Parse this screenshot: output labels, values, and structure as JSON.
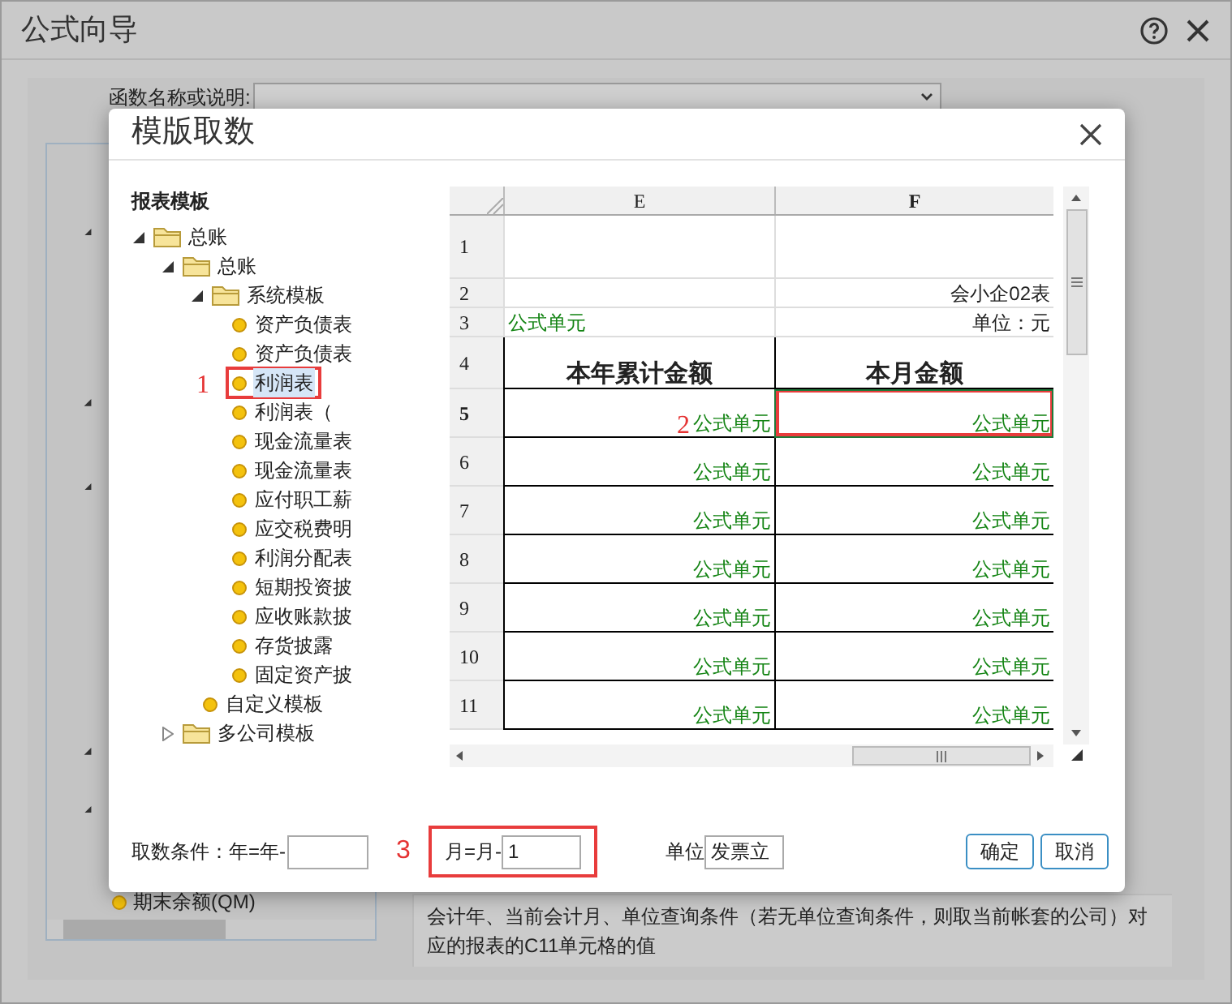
{
  "window": {
    "title": "公式向导"
  },
  "function_search": {
    "label": "函数名称或说明:"
  },
  "function_list": {
    "bottom_item": "期末余额(QM)"
  },
  "description": "会计年、当前会计月、单位查询条件（若无单位查询条件，则取当前帐套的公司）对应的报表的C11单元格的值",
  "dialog": {
    "title": "模版取数",
    "tree_heading": "报表模板",
    "tree": [
      {
        "kind": "folder",
        "label": "总账",
        "expanded": true,
        "children": [
          {
            "kind": "folder",
            "label": "总账",
            "expanded": true,
            "children": [
              {
                "kind": "folder",
                "label": "系统模板",
                "expanded": true,
                "children": [
                  {
                    "kind": "leaf",
                    "label": "资产负债表",
                    "selected": false,
                    "highlighted": false
                  },
                  {
                    "kind": "leaf",
                    "label": "资产负债表",
                    "selected": false,
                    "highlighted": false
                  },
                  {
                    "kind": "leaf",
                    "label": "利润表",
                    "selected": true,
                    "highlighted": true,
                    "marker": "1"
                  },
                  {
                    "kind": "leaf",
                    "label": "利润表（",
                    "selected": false,
                    "highlighted": false
                  },
                  {
                    "kind": "leaf",
                    "label": "现金流量表",
                    "selected": false,
                    "highlighted": false
                  },
                  {
                    "kind": "leaf",
                    "label": "现金流量表",
                    "selected": false,
                    "highlighted": false
                  },
                  {
                    "kind": "leaf",
                    "label": "应付职工薪",
                    "selected": false,
                    "highlighted": false
                  },
                  {
                    "kind": "leaf",
                    "label": "应交税费明",
                    "selected": false,
                    "highlighted": false
                  },
                  {
                    "kind": "leaf",
                    "label": "利润分配表",
                    "selected": false,
                    "highlighted": false
                  },
                  {
                    "kind": "leaf",
                    "label": "短期投资披",
                    "selected": false,
                    "highlighted": false
                  },
                  {
                    "kind": "leaf",
                    "label": "应收账款披",
                    "selected": false,
                    "highlighted": false
                  },
                  {
                    "kind": "leaf",
                    "label": "存货披露",
                    "selected": false,
                    "highlighted": false
                  },
                  {
                    "kind": "leaf",
                    "label": "固定资产披",
                    "selected": false,
                    "highlighted": false
                  }
                ]
              },
              {
                "kind": "leaf",
                "label": "自定义模板",
                "selected": false,
                "highlighted": false
              }
            ]
          },
          {
            "kind": "folder",
            "label": "多公司模板",
            "expanded": false
          }
        ]
      }
    ],
    "sheet": {
      "columns": [
        "E",
        "F"
      ],
      "rows": [
        {
          "number": "1",
          "kind": "title",
          "selected": false,
          "cells": [
            {
              "kind": "text"
            },
            {
              "kind": "text"
            }
          ]
        },
        {
          "number": "2",
          "kind": "small",
          "selected": false,
          "cells": [
            {
              "kind": "text"
            },
            {
              "kind": "text",
              "text": "会小企02表"
            }
          ]
        },
        {
          "number": "3",
          "kind": "small",
          "selected": false,
          "cells": [
            {
              "kind": "formula-left",
              "text": "公式单元"
            },
            {
              "kind": "text",
              "text": "单位：元"
            }
          ]
        },
        {
          "number": "4",
          "kind": "heading",
          "selected": false,
          "cells": [
            {
              "kind": "heading",
              "text": "本年累计金额"
            },
            {
              "kind": "heading",
              "text": "本月金额"
            }
          ]
        },
        {
          "number": "5",
          "kind": "data",
          "selected": true,
          "cells": [
            {
              "kind": "formula",
              "text": "公式单元",
              "marker": "2"
            },
            {
              "kind": "formula",
              "text": "公式单元",
              "selected": true,
              "highlighted": true
            }
          ]
        },
        {
          "number": "6",
          "kind": "data",
          "selected": false,
          "cells": [
            {
              "kind": "formula",
              "text": "公式单元"
            },
            {
              "kind": "formula",
              "text": "公式单元"
            }
          ]
        },
        {
          "number": "7",
          "kind": "data",
          "selected": false,
          "cells": [
            {
              "kind": "formula",
              "text": "公式单元"
            },
            {
              "kind": "formula",
              "text": "公式单元"
            }
          ]
        },
        {
          "number": "8",
          "kind": "data",
          "selected": false,
          "cells": [
            {
              "kind": "formula",
              "text": "公式单元"
            },
            {
              "kind": "formula",
              "text": "公式单元"
            }
          ]
        },
        {
          "number": "9",
          "kind": "data",
          "selected": false,
          "cells": [
            {
              "kind": "formula",
              "text": "公式单元"
            },
            {
              "kind": "formula",
              "text": "公式单元"
            }
          ]
        },
        {
          "number": "10",
          "kind": "data",
          "selected": false,
          "cells": [
            {
              "kind": "formula",
              "text": "公式单元"
            },
            {
              "kind": "formula",
              "text": "公式单元"
            }
          ]
        },
        {
          "number": "11",
          "kind": "data",
          "selected": false,
          "cells": [
            {
              "kind": "formula",
              "text": "公式单元"
            },
            {
              "kind": "formula",
              "text": "公式单元"
            }
          ]
        }
      ]
    },
    "conditions": {
      "label": "取数条件：年=年-",
      "marker": "3",
      "month_label": "月=月-",
      "month_value": "1",
      "month_highlighted": true,
      "unit_label": "单位",
      "unit_value": "发票立"
    },
    "buttons": [
      "确定",
      "取消"
    ]
  }
}
